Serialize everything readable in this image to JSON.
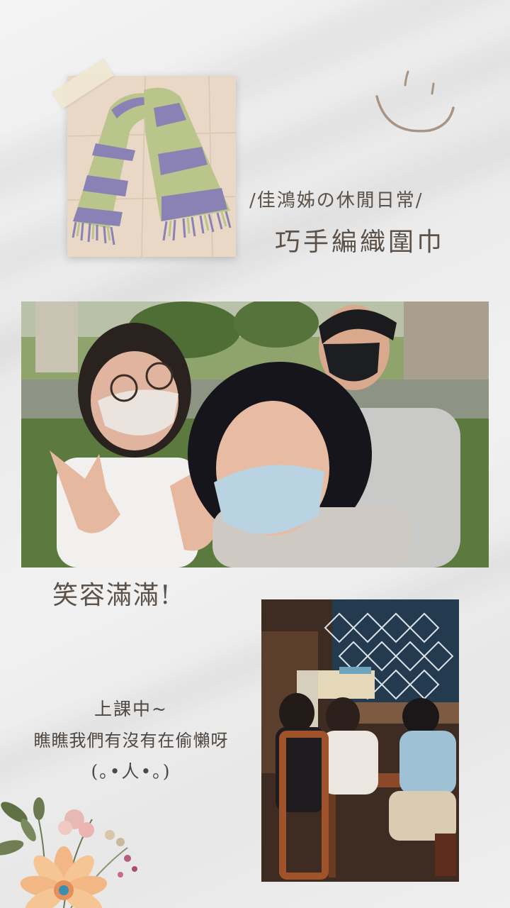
{
  "scarf_section": {
    "subtitle": "/佳鴻姊の休閒日常/",
    "title": "巧手編織圍巾"
  },
  "group_section": {
    "caption": "笑容滿滿!"
  },
  "class_section": {
    "line1": "上課中~",
    "line2": "瞧瞧我們有沒有在偷懶呀",
    "line3": "(｡•人•｡)"
  },
  "colors": {
    "text": "#5c5249",
    "scarf_purple": "#8a82b4",
    "scarf_green": "#b9c58a",
    "smiley": "#a89484"
  },
  "icons": {
    "smiley": "smiley-face-icon",
    "decor": "flower-bouquet-icon",
    "tape": "washi-tape"
  }
}
